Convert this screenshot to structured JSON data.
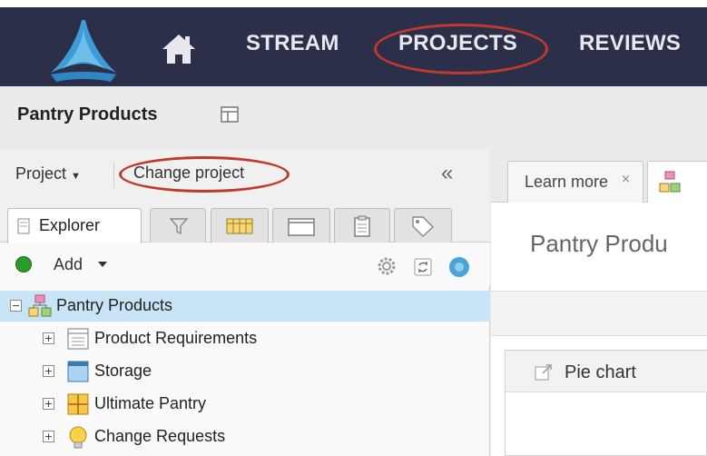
{
  "nav": {
    "items": [
      {
        "label": "STREAM"
      },
      {
        "label": "PROJECTS"
      },
      {
        "label": "REVIEWS"
      }
    ]
  },
  "project": {
    "title": "Pantry Products",
    "menu_label": "Project",
    "change_label": "Change project",
    "collapse_glyph": "«"
  },
  "explorer": {
    "tabs": [
      {
        "label": "Explorer",
        "icon": "explorer-icon"
      },
      {
        "label": "",
        "icon": "filter-icon"
      },
      {
        "label": "",
        "icon": "grid-icon"
      },
      {
        "label": "",
        "icon": "window-icon"
      },
      {
        "label": "",
        "icon": "clipboard-icon"
      },
      {
        "label": "",
        "icon": "tag-icon"
      }
    ],
    "add_label": "Add",
    "tree": [
      {
        "label": "Pantry Products",
        "level": 0,
        "expanded": true,
        "selected": true,
        "icon": "project-icon"
      },
      {
        "label": "Product Requirements",
        "level": 1,
        "expanded": false,
        "selected": false,
        "icon": "requirements-icon"
      },
      {
        "label": "Storage",
        "level": 1,
        "expanded": false,
        "selected": false,
        "icon": "storage-icon"
      },
      {
        "label": "Ultimate Pantry",
        "level": 1,
        "expanded": false,
        "selected": false,
        "icon": "component-icon"
      },
      {
        "label": "Change Requests",
        "level": 1,
        "expanded": false,
        "selected": false,
        "icon": "lightbulb-icon"
      }
    ]
  },
  "main": {
    "tab_label": "Learn more",
    "tab_close": "×",
    "page_title": "Pantry Produ",
    "widget_title": "Pie chart"
  },
  "colors": {
    "nav_bg": "#2b2f4a",
    "highlight": "#c0392b",
    "selected_row": "#c9e4f7",
    "add_green": "#2a9a2a"
  }
}
